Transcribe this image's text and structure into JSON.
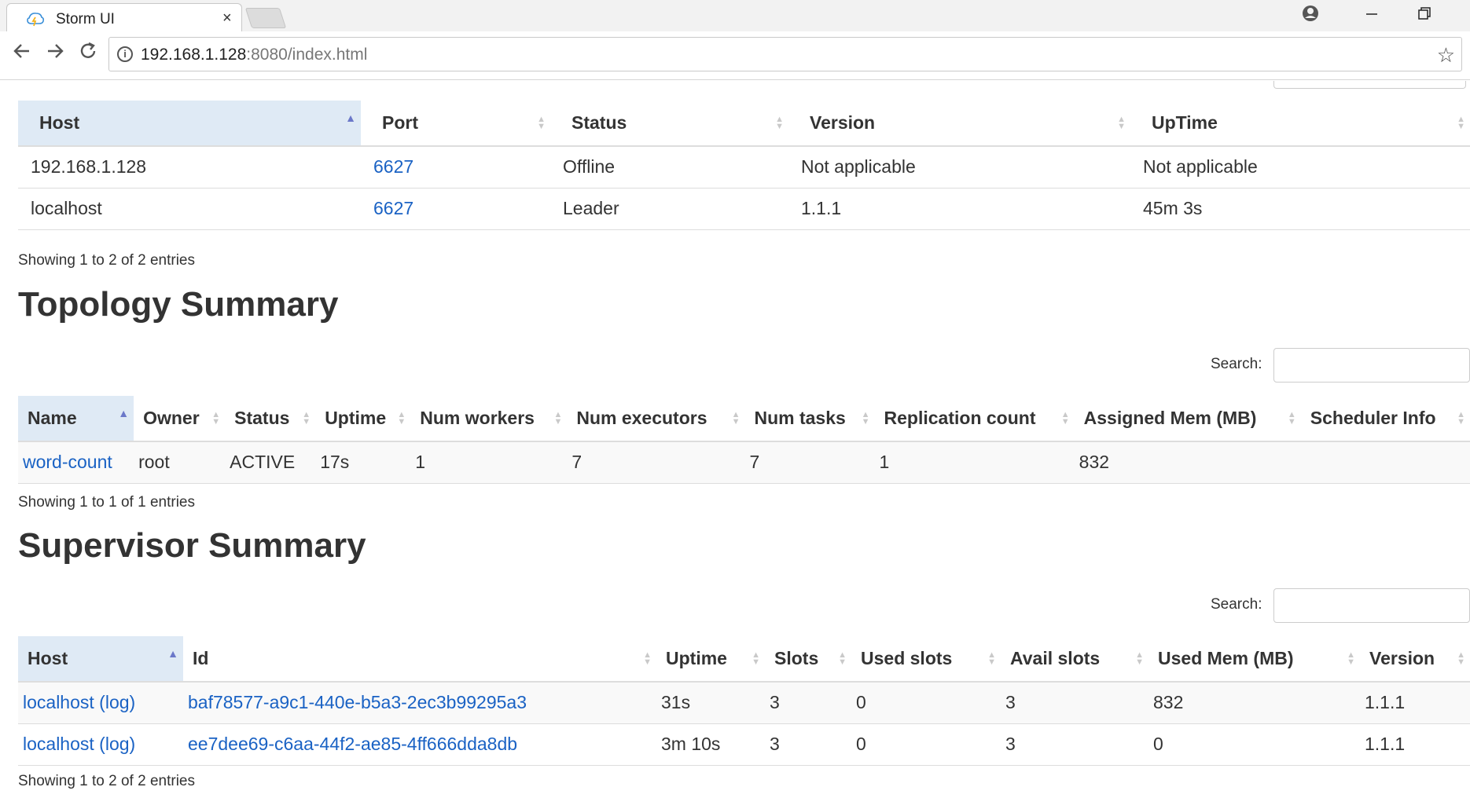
{
  "browser": {
    "tab_title": "Storm UI",
    "tab_close": "×",
    "url_host": "192.168.1.128",
    "url_rest": ":8080/index.html"
  },
  "nimbus": {
    "columns": [
      "Host",
      "Port",
      "Status",
      "Version",
      "UpTime"
    ],
    "rows": [
      {
        "host": "192.168.1.128",
        "port": "6627",
        "status": "Offline",
        "version": "Not applicable",
        "uptime": "Not applicable"
      },
      {
        "host": "localhost",
        "port": "6627",
        "status": "Leader",
        "version": "1.1.1",
        "uptime": "45m 3s"
      }
    ],
    "info": "Showing 1 to 2 of 2 entries"
  },
  "topology": {
    "title": "Topology Summary",
    "search_label": "Search:",
    "columns": [
      "Name",
      "Owner",
      "Status",
      "Uptime",
      "Num workers",
      "Num executors",
      "Num tasks",
      "Replication count",
      "Assigned Mem (MB)",
      "Scheduler Info"
    ],
    "rows": [
      {
        "name": "word-count",
        "owner": "root",
        "status": "ACTIVE",
        "uptime": "17s",
        "workers": "1",
        "executors": "7",
        "tasks": "7",
        "replication": "1",
        "mem": "832",
        "scheduler": ""
      }
    ],
    "info": "Showing 1 to 1 of 1 entries"
  },
  "supervisor": {
    "title": "Supervisor Summary",
    "search_label": "Search:",
    "columns": [
      "Host",
      "Id",
      "Uptime",
      "Slots",
      "Used slots",
      "Avail slots",
      "Used Mem (MB)",
      "Version"
    ],
    "rows": [
      {
        "host": "localhost",
        "log": "(log)",
        "id": "baf78577-a9c1-440e-b5a3-2ec3b99295a3",
        "uptime": "31s",
        "slots": "3",
        "used": "0",
        "avail": "3",
        "mem": "832",
        "version": "1.1.1"
      },
      {
        "host": "localhost",
        "log": "(log)",
        "id": "ee7dee69-c6aa-44f2-ae85-4ff666dda8db",
        "uptime": "3m 10s",
        "slots": "3",
        "used": "0",
        "avail": "3",
        "mem": "0",
        "version": "1.1.1"
      }
    ],
    "info": "Showing 1 to 2 of 2 entries"
  }
}
